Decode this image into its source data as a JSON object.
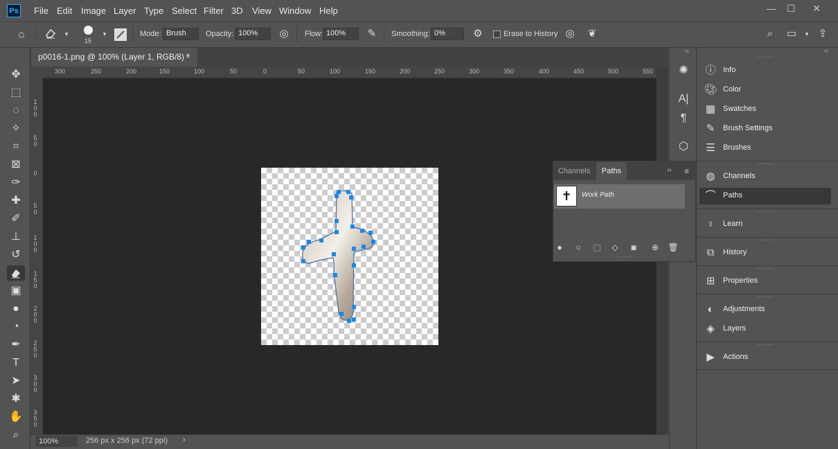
{
  "app": {
    "logo": "Ps"
  },
  "menu": [
    "File",
    "Edit",
    "Image",
    "Layer",
    "Type",
    "Select",
    "Filter",
    "3D",
    "View",
    "Window",
    "Help"
  ],
  "window_controls": {
    "minimize": "—",
    "maximize": "☐",
    "close": "✕"
  },
  "options": {
    "brush_size": "15",
    "mode_label": "Mode:",
    "mode_value": "Brush",
    "opacity_label": "Opacity:",
    "opacity_value": "100%",
    "flow_label": "Flow:",
    "flow_value": "100%",
    "smoothing_label": "Smoothing:",
    "smoothing_value": "0%",
    "erase_history_label": "Erase to History"
  },
  "document": {
    "tab_title": "p0016-1.png @ 100% (Layer 1, RGB/8) *",
    "close": "×",
    "zoom": "100%",
    "info": "256 px x 256 px (72 ppi)"
  },
  "ruler": {
    "h_labels": [
      "300",
      "250",
      "200",
      "150",
      "100",
      "50",
      "0",
      "50",
      "100",
      "150",
      "200",
      "250",
      "300",
      "350",
      "400",
      "450",
      "500",
      "550"
    ],
    "v_labels": [
      "1\n0\n0",
      "5\n0",
      "0",
      "5\n0",
      "1\n0\n0",
      "1\n5\n0",
      "2\n0\n0",
      "2\n5\n0",
      "3\n0\n0",
      "3\n5\n0"
    ]
  },
  "paths_panel": {
    "tabs": [
      "Channels",
      "Paths"
    ],
    "active_tab": "Paths",
    "items": [
      {
        "name": "Work Path"
      }
    ]
  },
  "right_dock": {
    "group1": [
      {
        "label": "Info",
        "icon": "info-icon"
      },
      {
        "label": "Color",
        "icon": "palette-icon"
      },
      {
        "label": "Swatches",
        "icon": "grid-icon"
      },
      {
        "label": "Brush Settings",
        "icon": "brush-settings-icon"
      },
      {
        "label": "Brushes",
        "icon": "brushes-icon"
      }
    ],
    "group2": [
      {
        "label": "Channels",
        "icon": "channels-icon"
      },
      {
        "label": "Paths",
        "icon": "paths-icon"
      }
    ],
    "group3": [
      {
        "label": "Learn",
        "icon": "bulb-icon"
      }
    ],
    "group4": [
      {
        "label": "History",
        "icon": "history-icon"
      }
    ],
    "group5": [
      {
        "label": "Properties",
        "icon": "properties-icon"
      }
    ],
    "group6": [
      {
        "label": "Adjustments",
        "icon": "adjustments-icon"
      },
      {
        "label": "Layers",
        "icon": "layers-icon"
      }
    ],
    "group7": [
      {
        "label": "Actions",
        "icon": "play-icon"
      }
    ]
  },
  "colors": {
    "accent": "#31a8ff",
    "canvas_bg": "#282828",
    "panel_bg": "#535353",
    "path_anchor": "#1e88e5"
  }
}
